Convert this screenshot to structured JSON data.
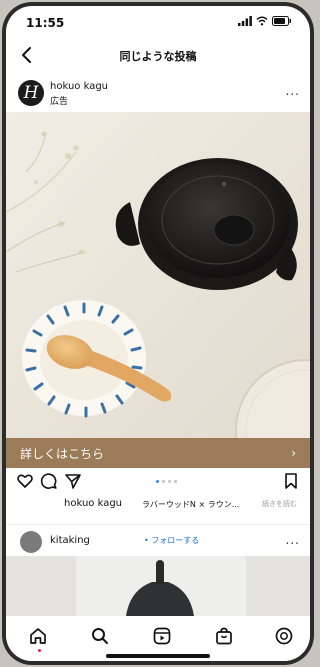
{
  "status_bar": {
    "time": "11:55"
  },
  "header": {
    "title": "同じような投稿"
  },
  "post": {
    "account_name": "hokuo kagu",
    "sponsored_label": "広告",
    "avatar_letter": "H",
    "more": "...",
    "cta_label": "詳しくはこちら",
    "cta_arrow": "›",
    "carousel_dots": 4,
    "carousel_active_index": 0,
    "caption_account": "hokuo kagu",
    "caption_text": "ラバーウッドN × ラウン...",
    "caption_more": "続きを読む"
  },
  "next_post": {
    "account_name": "kitaking",
    "follow_label": "• フォローする",
    "more": "..."
  },
  "tabbar": {
    "items": [
      "home-icon",
      "search-icon",
      "reels-icon",
      "shop-icon",
      "profile-icon"
    ]
  },
  "colors": {
    "cta_bg": "#9b7b58",
    "follow": "#1d6fe0",
    "active_dot": "#3b82f6"
  }
}
